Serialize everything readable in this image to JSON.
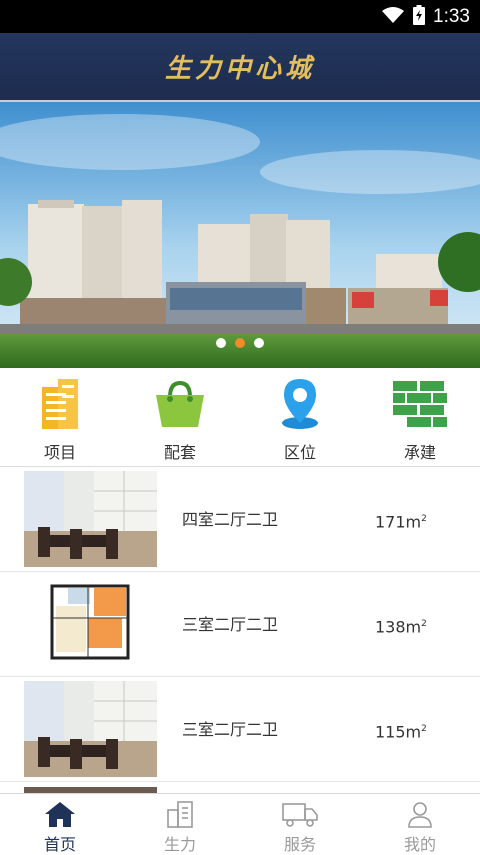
{
  "status_bar": {
    "time": "1:33"
  },
  "header": {
    "title": "生力中心城"
  },
  "banner": {
    "slide_count": 3,
    "active_index": 1
  },
  "categories": [
    {
      "label": "项目",
      "icon": "building-icon"
    },
    {
      "label": "配套",
      "icon": "shopping-bag-icon"
    },
    {
      "label": "区位",
      "icon": "location-pin-icon"
    },
    {
      "label": "承建",
      "icon": "bricks-icon"
    }
  ],
  "listings": [
    {
      "name": "四室二厅二卫",
      "area": "171m",
      "area_unit": "2",
      "image": "dining-room-photo"
    },
    {
      "name": "三室二厅二卫",
      "area": "138m",
      "area_unit": "2",
      "image": "floor-plan"
    },
    {
      "name": "三室二厅二卫",
      "area": "115m",
      "area_unit": "2",
      "image": "dining-room-photo"
    }
  ],
  "tabs": [
    {
      "label": "首页",
      "icon": "home-icon",
      "active": true
    },
    {
      "label": "生力",
      "icon": "buildings-icon",
      "active": false
    },
    {
      "label": "服务",
      "icon": "truck-icon",
      "active": false
    },
    {
      "label": "我的",
      "icon": "user-icon",
      "active": false
    }
  ],
  "colors": {
    "header_bg": "#1d2c4f",
    "title_gold": "#e2bf5c",
    "active_dot": "#f18b2a",
    "tab_active": "#1f3358"
  }
}
